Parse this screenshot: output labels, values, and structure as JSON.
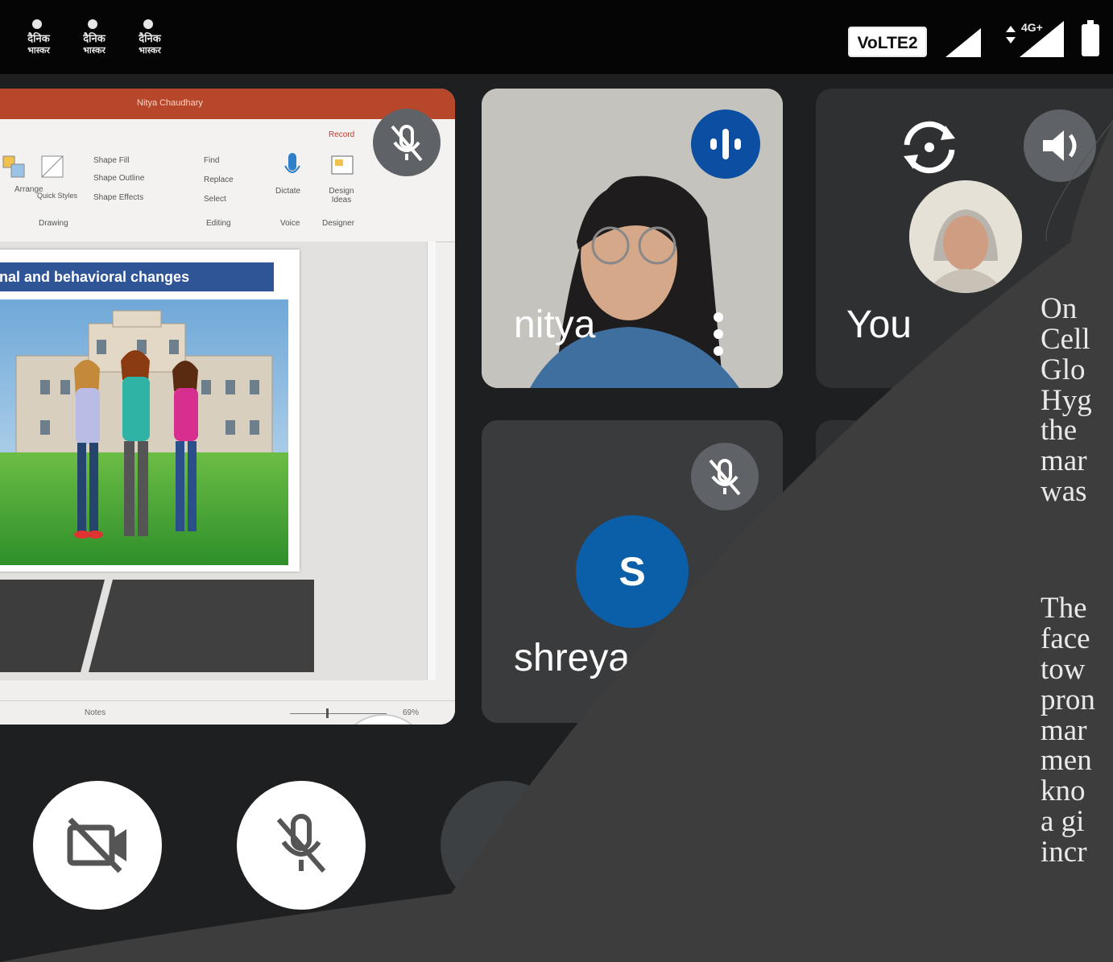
{
  "status_bar": {
    "news_icons": [
      {
        "line1": "दैनिक",
        "line2": "भास्कर"
      },
      {
        "line1": "दैनिक",
        "line2": "भास्कर"
      },
      {
        "line1": "दैनिक",
        "line2": "भास्कर"
      }
    ],
    "volte_label": "VoLTE2",
    "network_label": "4G+",
    "icons": [
      "newspaper-app-icon",
      "signal-icon",
      "data-arrows-icon",
      "battery-icon"
    ]
  },
  "presentation": {
    "slide_title": "nal and behavioral changes",
    "window_title": "Nitya Chaudhary",
    "ribbon_labels": [
      "Arrange",
      "Quick Styles",
      "Shape Fill",
      "Shape Outline",
      "Shape Effects",
      "Drawing",
      "Find",
      "Replace",
      "Select",
      "Editing",
      "Dictate",
      "Voice",
      "Design Ideas",
      "Designer",
      "Record"
    ],
    "status_labels": [
      "Notes",
      "69%"
    ]
  },
  "participants": {
    "nitya": {
      "name": "nitya"
    },
    "you": {
      "name": "You"
    },
    "shreya": {
      "name": "shreya",
      "initial": "S",
      "avatar_color": "#0b5fa8"
    }
  },
  "controls": {
    "icons": [
      "camera-off-icon",
      "mic-off-icon",
      "more-options-icon"
    ]
  },
  "slide_text": {
    "lines": [
      "On",
      "Cell",
      "Glo",
      "Hyg",
      "the",
      "mar",
      "was",
      "",
      "The",
      "face",
      "tow",
      "pron",
      "mar",
      "men",
      "kno",
      "a gi",
      "incr"
    ]
  },
  "colors": {
    "tile_bg": "#3a3b3d",
    "speaking_blue": "#0b4ea2",
    "muted_grey": "#5f6368",
    "slide_overlay": "#3d3d3d"
  }
}
